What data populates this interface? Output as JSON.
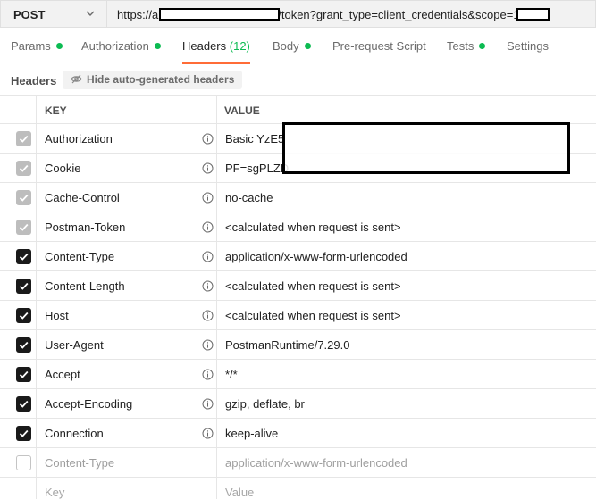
{
  "request": {
    "method": "POST",
    "url_prefix": "https://a",
    "url_suffix": "/token?grant_type=client_credentials&scope=1"
  },
  "tabs": [
    {
      "label": "Params",
      "dot": true
    },
    {
      "label": "Authorization",
      "dot": true
    },
    {
      "label": "Headers",
      "count": "(12)",
      "active": true
    },
    {
      "label": "Body",
      "dot": true
    },
    {
      "label": "Pre-request Script",
      "dot": false
    },
    {
      "label": "Tests",
      "dot": true
    },
    {
      "label": "Settings",
      "dot": false
    }
  ],
  "subheader": {
    "title": "Headers",
    "hide_button": "Hide auto-generated headers"
  },
  "table": {
    "col_key": "KEY",
    "col_value": "VALUE",
    "rows": [
      {
        "key": "Authorization",
        "value": "Basic YzE5",
        "state": "dim",
        "info": true
      },
      {
        "key": "Cookie",
        "value": "PF=sgPLZD",
        "state": "dim",
        "info": true
      },
      {
        "key": "Cache-Control",
        "value": "no-cache",
        "state": "dim",
        "info": true
      },
      {
        "key": "Postman-Token",
        "value": "<calculated when request is sent>",
        "state": "dim",
        "info": true
      },
      {
        "key": "Content-Type",
        "value": "application/x-www-form-urlencoded",
        "state": "on",
        "info": true
      },
      {
        "key": "Content-Length",
        "value": "<calculated when request is sent>",
        "state": "on",
        "info": true
      },
      {
        "key": "Host",
        "value": "<calculated when request is sent>",
        "state": "on",
        "info": true
      },
      {
        "key": "User-Agent",
        "value": "PostmanRuntime/7.29.0",
        "state": "on",
        "info": true
      },
      {
        "key": "Accept",
        "value": "*/*",
        "state": "on",
        "info": true
      },
      {
        "key": "Accept-Encoding",
        "value": "gzip, deflate, br",
        "state": "on",
        "info": true
      },
      {
        "key": "Connection",
        "value": "keep-alive",
        "state": "on",
        "info": true
      },
      {
        "key": "Content-Type",
        "value": "application/x-www-form-urlencoded",
        "state": "off",
        "info": false,
        "faded": true
      },
      {
        "key": "Key",
        "value": "Value",
        "state": "none",
        "info": false,
        "placeholder": true
      }
    ]
  },
  "colors": {
    "accent": "#ff6c37",
    "green_dot": "#0cbb52"
  }
}
